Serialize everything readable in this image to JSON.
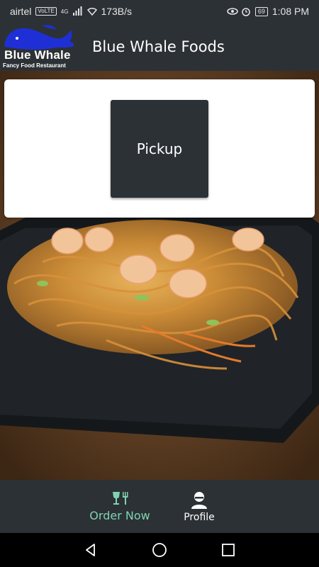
{
  "status_bar": {
    "carrier": "airtel",
    "volte": "VoLTE",
    "network": "4G",
    "speed": "173B/s",
    "battery": "69",
    "time": "1:08 PM"
  },
  "app_bar": {
    "logo_name": "Blue Whale",
    "logo_tagline": "Fancy Food Restaurant",
    "title": "Blue Whale Foods"
  },
  "card": {
    "pickup_label": "Pickup"
  },
  "bottom_nav": {
    "items": [
      {
        "label": "Order Now",
        "icon": "glass-fork-icon",
        "active": true
      },
      {
        "label": "Profile",
        "icon": "person-icon",
        "active": false
      }
    ]
  },
  "colors": {
    "bar": "#2c3135",
    "accent": "#7fd3b0",
    "logo_blue": "#1f2fd6"
  }
}
